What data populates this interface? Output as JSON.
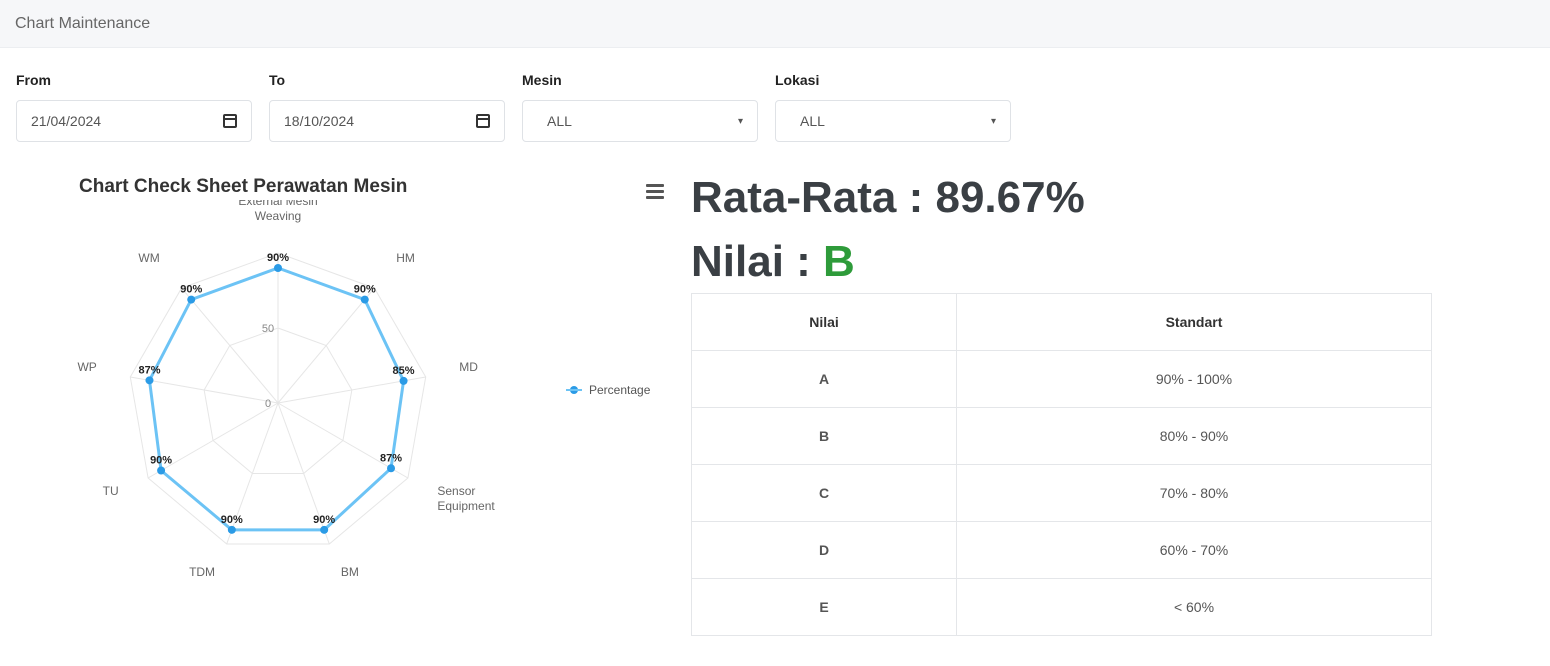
{
  "header": {
    "title": "Chart Maintenance"
  },
  "filters": {
    "from": {
      "label": "From",
      "value": "21/04/2024"
    },
    "to": {
      "label": "To",
      "value": "18/10/2024"
    },
    "mesin": {
      "label": "Mesin",
      "value": "ALL"
    },
    "lokasi": {
      "label": "Lokasi",
      "value": "ALL"
    }
  },
  "chart_data": {
    "type": "radar",
    "title": "Chart Check Sheet Perawatan Mesin",
    "categories": [
      "External Mesin Weaving",
      "HM",
      "MD",
      "Sensor Equipment",
      "BM",
      "TDM",
      "TU",
      "WP",
      "WM"
    ],
    "series": [
      {
        "name": "Percentage",
        "values": [
          90,
          90,
          85,
          87,
          90,
          90,
          90,
          87,
          90
        ],
        "labels": [
          "90%",
          "90%",
          "85%",
          "87%",
          "90%",
          "90%",
          "90%",
          "87%",
          "90%"
        ]
      }
    ],
    "radial_ticks": [
      "0",
      "50"
    ],
    "rmax": 100,
    "legend_position": "right",
    "color": "#6cc3f5"
  },
  "summary": {
    "average_label": "Rata-Rata : 89.67%",
    "grade_label": "Nilai : ",
    "grade_value": "B"
  },
  "standards_table": {
    "headers": [
      "Nilai",
      "Standart"
    ],
    "rows": [
      {
        "grade": "A",
        "range": "90% - 100%"
      },
      {
        "grade": "B",
        "range": "80% - 90%"
      },
      {
        "grade": "C",
        "range": "70% - 80%"
      },
      {
        "grade": "D",
        "range": "60% - 70%"
      },
      {
        "grade": "E",
        "range": "< 60%"
      }
    ]
  }
}
